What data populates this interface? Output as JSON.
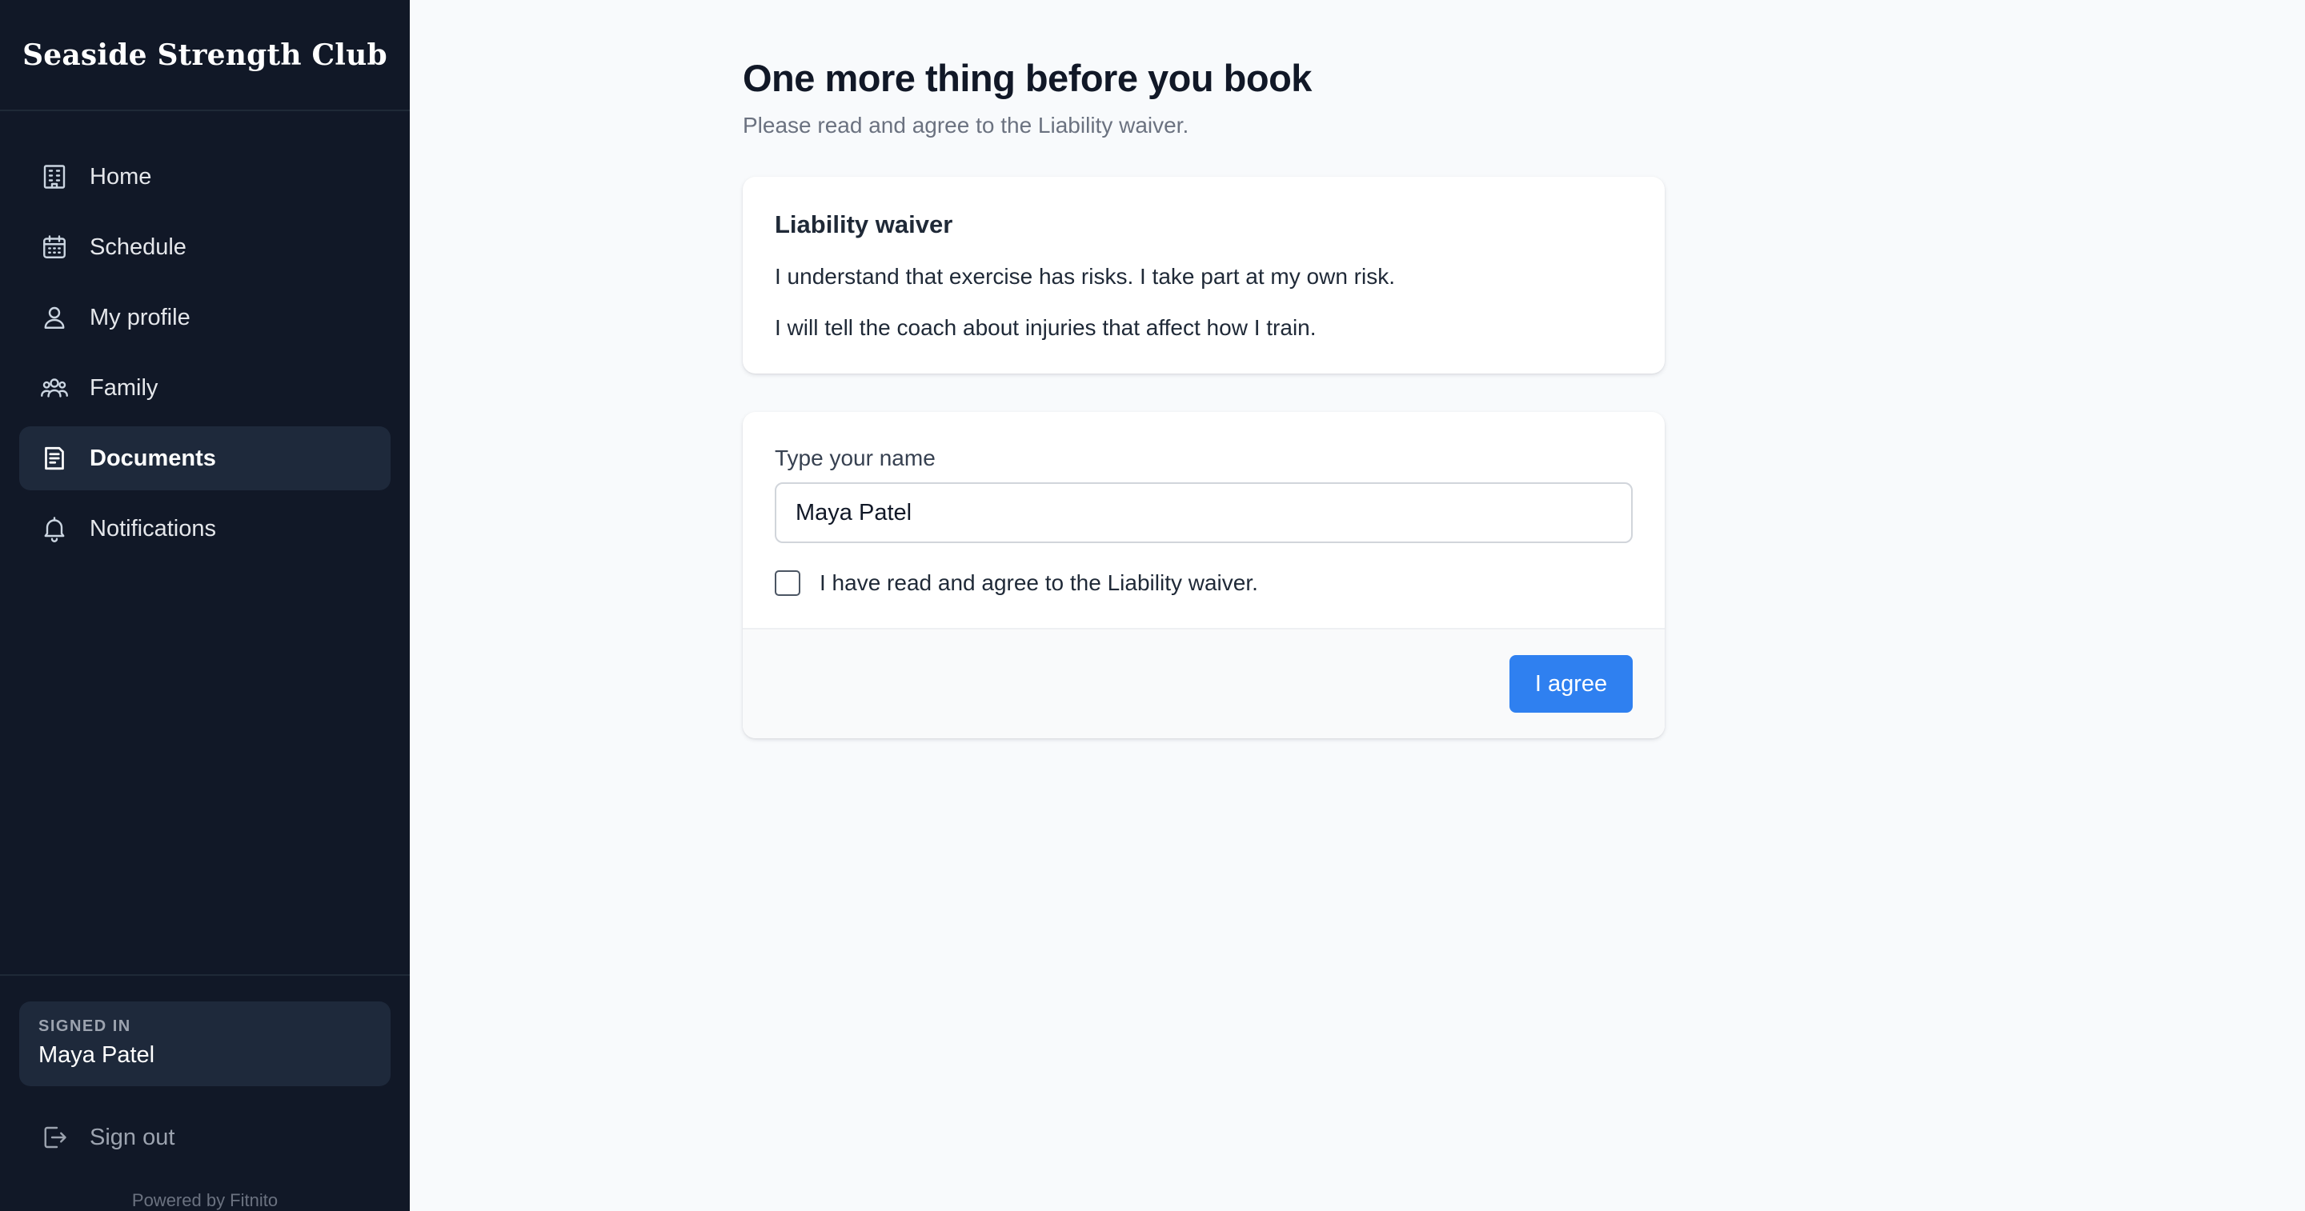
{
  "sidebar": {
    "brand": "Seaside Strength Club",
    "items": [
      {
        "label": "Home",
        "icon": "building-icon"
      },
      {
        "label": "Schedule",
        "icon": "calendar-icon"
      },
      {
        "label": "My profile",
        "icon": "user-icon"
      },
      {
        "label": "Family",
        "icon": "users-icon"
      },
      {
        "label": "Documents",
        "icon": "document-icon",
        "active": true
      },
      {
        "label": "Notifications",
        "icon": "bell-icon"
      }
    ],
    "signed_in_label": "SIGNED IN",
    "signed_in_name": "Maya Patel",
    "sign_out": "Sign out",
    "powered_by": "Powered by Fitnito"
  },
  "main": {
    "title": "One more thing before you book",
    "subtitle": "Please read and agree to the Liability waiver.",
    "waiver": {
      "title": "Liability waiver",
      "lines": [
        "I understand that exercise has risks. I take part at my own risk.",
        "I will tell the coach about injuries that affect how I train."
      ]
    },
    "form": {
      "name_label": "Type your name",
      "name_value": "Maya Patel",
      "agree_checkbox_label": "I have read and agree to the Liability waiver.",
      "agree_checked": false,
      "submit_label": "I agree"
    }
  },
  "colors": {
    "sidebar_bg": "#111827",
    "active_item_bg": "#1e293b",
    "primary_button": "#2f80f0",
    "page_bg": "#f8fafc"
  }
}
